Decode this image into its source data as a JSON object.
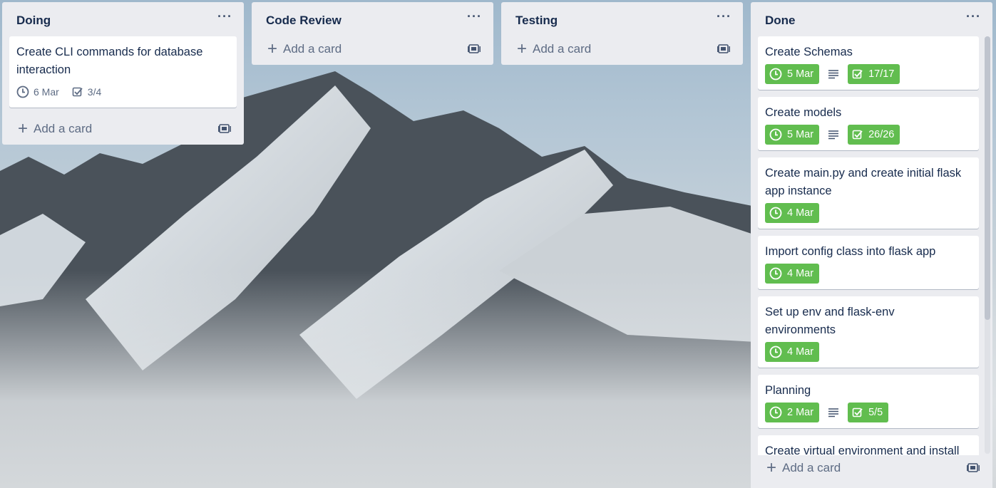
{
  "colors": {
    "list_bg": "#ebecf0",
    "badge_green": "#61bd4f",
    "text": "#172b4d",
    "muted": "#5e6c84"
  },
  "lists": [
    {
      "title": "Doing",
      "cards": [
        {
          "title": "Create CLI commands for database interaction",
          "due": "6 Mar",
          "checklist": "3/4"
        }
      ],
      "add_label": "Add a card"
    },
    {
      "title": "Code Review",
      "add_label": "Add a card"
    },
    {
      "title": "Testing",
      "add_label": "Add a card"
    },
    {
      "title": "Done",
      "cards": [
        {
          "title": "Create Schemas",
          "due": "5 Mar",
          "checklist": "17/17"
        },
        {
          "title": "Create models",
          "due": "5 Mar",
          "checklist": "26/26"
        },
        {
          "title": "Create main.py and create initial flask app instance",
          "due": "4 Mar"
        },
        {
          "title": "Import config class into flask app",
          "due": "4 Mar"
        },
        {
          "title": "Set up env and flask-env environments",
          "due": "4 Mar"
        },
        {
          "title": "Planning",
          "due": "2 Mar",
          "checklist": "5/5"
        },
        {
          "title": "Create virtual environment and install"
        }
      ],
      "add_label": "Add a card"
    }
  ],
  "menu_glyph": "···",
  "plus_glyph": "+"
}
